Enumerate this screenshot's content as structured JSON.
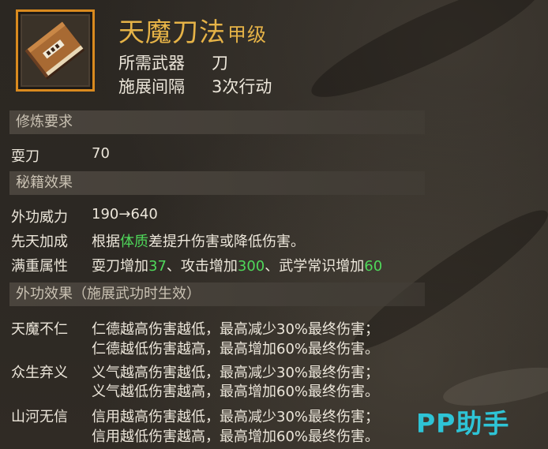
{
  "skill": {
    "title": "天魔刀法",
    "grade": "甲级",
    "icon": "book-icon",
    "weapon_label": "所需武器",
    "weapon_value": "刀",
    "interval_label": "施展间隔",
    "interval_value": "3次行动"
  },
  "requirements": {
    "header": "修炼要求",
    "rows": [
      {
        "label": "耍刀",
        "value": "70"
      }
    ]
  },
  "effects": {
    "header": "秘籍效果",
    "power_label": "外功威力",
    "power_value": "190→640",
    "innate_label": "先天加成",
    "innate_pre": "根据",
    "innate_highlight": "体质",
    "innate_post": "差提升伤害或降低伤害。",
    "full_label": "满重属性",
    "full_t1": "耍刀增加",
    "full_v1": "37",
    "full_t2": "、攻击增加",
    "full_v2": "300",
    "full_t3": "、武学常识增加",
    "full_v3": "60"
  },
  "outer_effects": {
    "header": "外功效果（施展武功时生效）",
    "items": [
      {
        "label": "天魔不仁",
        "line1": "仁德越高伤害越低，最高减少30%最终伤害；",
        "line2": "仁德越低伤害越高，最高增加60%最终伤害。"
      },
      {
        "label": "众生弃义",
        "line1": "义气越高伤害越低，最高减少30%最终伤害；",
        "line2": "义气越低伤害越高，最高增加60%最终伤害。"
      },
      {
        "label": "山河无信",
        "line1": "信用越高伤害越低，最高减少30%最终伤害；",
        "line2": "信用越低伤害越高，最高增加60%最终伤害。"
      }
    ]
  },
  "watermark": "PP助手",
  "colors": {
    "title": "#e6b347",
    "highlight": "#4fd85a",
    "frame": "#d98a1f",
    "watermark": "#2ec4d6"
  }
}
